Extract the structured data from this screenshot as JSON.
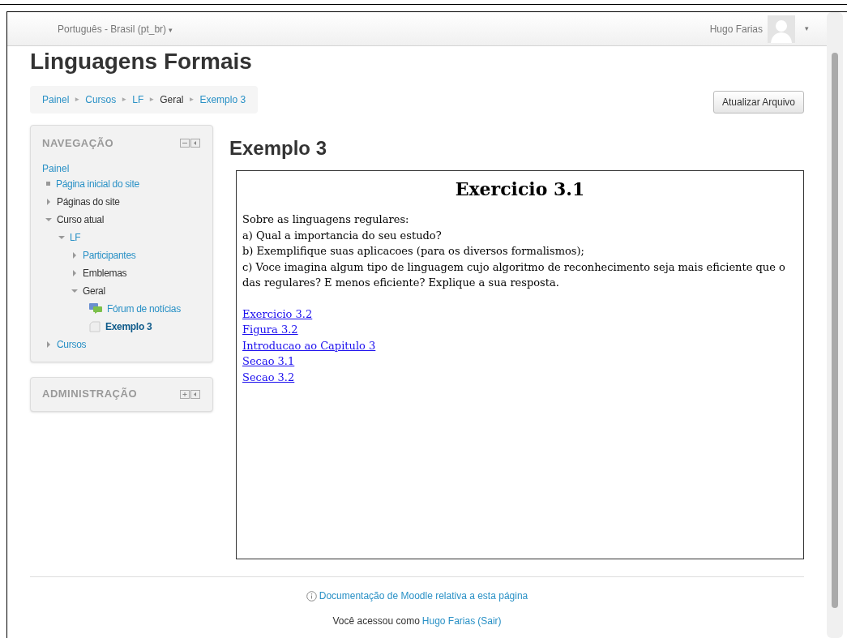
{
  "navbar": {
    "language": "Português - Brasil (pt_br)",
    "language_caret": "▾",
    "user": "Hugo Farias",
    "user_caret": "▾"
  },
  "site_title": "Linguagens Formais",
  "breadcrumb": [
    {
      "label": "Painel",
      "link": true
    },
    {
      "label": "Cursos",
      "link": true
    },
    {
      "label": "LF",
      "link": true
    },
    {
      "label": "Geral",
      "link": false
    },
    {
      "label": "Exemplo 3",
      "link": true
    }
  ],
  "breadcrumb_separator": "►",
  "update_button": "Atualizar Arquivo",
  "navigation": {
    "title": "NAVEGAÇÃO",
    "root": "Painel",
    "items": [
      {
        "label": "Página inicial do site",
        "kind": "bullet",
        "link": true,
        "selected": false
      },
      {
        "label": "Páginas do site",
        "kind": "branch",
        "link": false,
        "expanded": false,
        "selected": false
      },
      {
        "label": "Curso atual",
        "kind": "branch",
        "link": false,
        "expanded": true,
        "selected": false,
        "children": [
          {
            "label": "LF",
            "kind": "branch",
            "link": true,
            "expanded": true,
            "selected": false,
            "children": [
              {
                "label": "Participantes",
                "kind": "branch",
                "link": true,
                "expanded": false,
                "selected": false
              },
              {
                "label": "Emblemas",
                "kind": "branch",
                "link": false,
                "expanded": false,
                "selected": false
              },
              {
                "label": "Geral",
                "kind": "branch",
                "link": false,
                "expanded": true,
                "selected": false,
                "children": [
                  {
                    "label": "Fórum de notícias",
                    "kind": "forum",
                    "link": true,
                    "selected": false
                  },
                  {
                    "label": "Exemplo 3",
                    "kind": "page",
                    "selected": true
                  }
                ]
              }
            ]
          }
        ]
      },
      {
        "label": "Cursos",
        "kind": "branch",
        "link": true,
        "expanded": false,
        "selected": false
      }
    ]
  },
  "administration": {
    "title": "ADMINISTRAÇÃO"
  },
  "page_heading": "Exemplo 3",
  "content": {
    "title": "Exercicio 3.1",
    "lines": [
      "Sobre as linguagens regulares:",
      "a) Qual a importancia do seu estudo?",
      "b) Exemplifique suas aplicacoes (para os diversos formalismos);",
      "c) Voce imagina algum tipo de linguagem cujo algoritmo de reconhecimento seja mais eficiente que o das regulares? E menos eficiente? Explique a sua resposta."
    ],
    "links": [
      "Exercicio 3.2",
      "Figura 3.2",
      "Introducao ao Capitulo 3",
      "Secao 3.1",
      "Secao 3.2"
    ]
  },
  "footer": {
    "doc_link": "Documentação de Moodle relativa a esta página",
    "logged_in_prefix": "Você acessou como",
    "user_link": "Hugo Farias",
    "logout_link": "(Sair)"
  }
}
